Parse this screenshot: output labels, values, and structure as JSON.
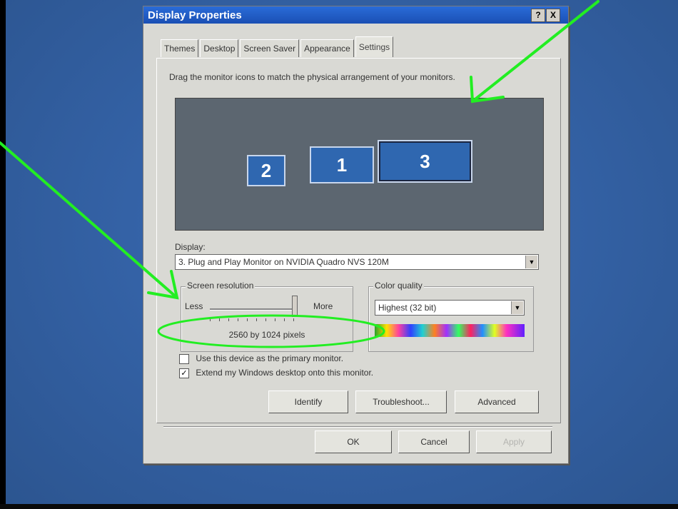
{
  "window": {
    "title": "Display Properties",
    "help_label": "?",
    "close_label": "X"
  },
  "tabs": [
    {
      "label": "Themes"
    },
    {
      "label": "Desktop"
    },
    {
      "label": "Screen Saver"
    },
    {
      "label": "Appearance"
    },
    {
      "label": "Settings"
    }
  ],
  "settings": {
    "instruction": "Drag the monitor icons to match the physical arrangement of your monitors.",
    "monitors": [
      {
        "label": "2"
      },
      {
        "label": "1"
      },
      {
        "label": "3"
      }
    ],
    "display_label": "Display:",
    "display_value": "3. Plug and Play Monitor on NVIDIA Quadro NVS 120M",
    "screen_resolution": {
      "title": "Screen resolution",
      "less_label": "Less",
      "more_label": "More",
      "value_text": "2560 by 1024 pixels"
    },
    "color_quality": {
      "title": "Color quality",
      "value": "Highest (32 bit)"
    },
    "checkboxes": {
      "primary": {
        "label": "Use this device as the primary monitor.",
        "checked_mark": ""
      },
      "extend": {
        "label": "Extend my Windows desktop onto this monitor.",
        "checked_mark": "✓"
      }
    },
    "buttons": {
      "identify": "Identify",
      "troubleshoot": "Troubleshoot...",
      "advanced": "Advanced"
    }
  },
  "footer": {
    "ok": "OK",
    "cancel": "Cancel",
    "apply": "Apply"
  },
  "colors": {
    "titlebar": "#1a4fb4",
    "monitor_fill": "#2f67b0",
    "annotation": "#22ee22"
  }
}
